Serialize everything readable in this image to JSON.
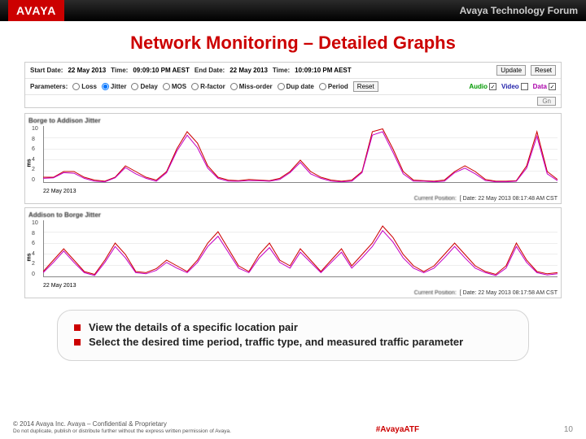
{
  "header": {
    "logo": "AVAYA",
    "forum": "Avaya Technology Forum"
  },
  "title": "Network Monitoring – Detailed Graphs",
  "controls": {
    "start_label": "Start Date:",
    "start_date": "22 May 2013",
    "start_time_label": "Time:",
    "start_time": "09:09:10 PM AEST",
    "end_label": "End Date:",
    "end_date": "22 May 2013",
    "end_time_label": "Time:",
    "end_time": "10:09:10 PM AEST",
    "update": "Update",
    "reset": "Reset",
    "param_label": "Parameters:",
    "params": [
      "Loss",
      "Jitter",
      "Delay",
      "MOS",
      "R-factor",
      "Miss-order",
      "Dup date",
      "Period"
    ],
    "selected_param": "Jitter",
    "audio": "Audio",
    "video": "Video",
    "data": "Data",
    "gn": "Gn"
  },
  "chart_data": [
    {
      "type": "line",
      "title": "Borge to Addison Jitter",
      "ylabel": "ms",
      "ylim": [
        0,
        10
      ],
      "yticks": [
        10,
        8,
        6,
        4,
        2,
        0
      ],
      "xdate": "22 May 2013",
      "current": "Current Position:",
      "date_val": "Date: 22 May 2013 08:17:48 AM CST",
      "x": [
        0,
        2,
        4,
        6,
        8,
        10,
        12,
        14,
        16,
        18,
        20,
        22,
        24,
        26,
        28,
        30,
        32,
        34,
        36,
        38,
        40,
        42,
        44,
        46,
        48,
        50,
        52,
        54,
        56,
        58,
        60,
        62,
        64,
        66,
        68,
        70,
        72,
        74,
        76,
        78,
        80,
        82,
        84,
        86,
        88,
        90,
        92,
        94,
        96,
        98,
        100
      ],
      "series": [
        {
          "name": "Audio",
          "color": "#cc0000",
          "values": [
            1,
            1,
            2,
            2,
            1,
            0.5,
            0.3,
            1,
            3,
            2,
            1,
            0.5,
            2,
            6,
            9,
            7,
            3,
            1,
            0.5,
            0.4,
            0.6,
            0.5,
            0.4,
            0.8,
            2,
            4,
            2,
            1,
            0.5,
            0.3,
            0.5,
            2,
            9,
            9.5,
            6,
            2,
            0.5,
            0.4,
            0.3,
            0.5,
            2,
            3,
            2,
            0.6,
            0.3,
            0.3,
            0.4,
            3,
            9,
            2,
            0.6
          ]
        },
        {
          "name": "Data",
          "color": "#c400c4",
          "values": [
            0.8,
            0.9,
            1.8,
            1.7,
            0.8,
            0.3,
            0.2,
            0.9,
            2.7,
            1.6,
            0.8,
            0.3,
            1.8,
            5.6,
            8.4,
            6.2,
            2.6,
            0.8,
            0.3,
            0.3,
            0.4,
            0.4,
            0.3,
            0.6,
            1.8,
            3.6,
            1.6,
            0.8,
            0.3,
            0.2,
            0.3,
            1.8,
            8.4,
            9,
            5.4,
            1.6,
            0.3,
            0.3,
            0.2,
            0.3,
            1.8,
            2.6,
            1.6,
            0.4,
            0.2,
            0.2,
            0.3,
            2.6,
            8.2,
            1.6,
            0.4
          ]
        }
      ]
    },
    {
      "type": "line",
      "title": "Addison to Borge Jitter",
      "ylabel": "ms",
      "ylim": [
        0,
        10
      ],
      "yticks": [
        10,
        8,
        6,
        4,
        2,
        0
      ],
      "xdate": "22 May 2013",
      "current": "Current Position:",
      "date_val": "Date: 22 May 2013 08:17:58 AM CST",
      "x": [
        0,
        2,
        4,
        6,
        8,
        10,
        12,
        14,
        16,
        18,
        20,
        22,
        24,
        26,
        28,
        30,
        32,
        34,
        36,
        38,
        40,
        42,
        44,
        46,
        48,
        50,
        52,
        54,
        56,
        58,
        60,
        62,
        64,
        66,
        68,
        70,
        72,
        74,
        76,
        78,
        80,
        82,
        84,
        86,
        88,
        90,
        92,
        94,
        96,
        98,
        100
      ],
      "series": [
        {
          "name": "Audio",
          "color": "#cc0000",
          "values": [
            1,
            3,
            5,
            3,
            1,
            0.5,
            3,
            6,
            4,
            1,
            0.8,
            1.5,
            3,
            2,
            1,
            3,
            6,
            8,
            5,
            2,
            1,
            4,
            6,
            3,
            2,
            5,
            3,
            1,
            3,
            5,
            2,
            4,
            6,
            9,
            7,
            4,
            2,
            1,
            2,
            4,
            6,
            4,
            2,
            1,
            0.5,
            2,
            6,
            3,
            1,
            0.6,
            0.8
          ]
        },
        {
          "name": "Data",
          "color": "#c400c4",
          "values": [
            0.8,
            2.6,
            4.6,
            2.6,
            0.8,
            0.3,
            2.6,
            5.4,
            3.4,
            0.8,
            0.6,
            1.2,
            2.6,
            1.6,
            0.8,
            2.6,
            5.4,
            7.2,
            4.4,
            1.6,
            0.8,
            3.4,
            5.2,
            2.6,
            1.6,
            4.4,
            2.6,
            0.8,
            2.6,
            4.4,
            1.6,
            3.4,
            5.4,
            8.2,
            6.2,
            3.4,
            1.6,
            0.8,
            1.6,
            3.4,
            5.4,
            3.4,
            1.6,
            0.8,
            0.3,
            1.6,
            5.4,
            2.6,
            0.8,
            0.4,
            0.6
          ]
        }
      ]
    }
  ],
  "bullets": {
    "b1": "View the details of a specific location pair",
    "b2": "Select the desired time period, traffic type, and measured traffic parameter"
  },
  "footer": {
    "copy": "© 2014 Avaya Inc. Avaya – Confidential & Proprietary",
    "sub": "Do not duplicate, publish or distribute further without the express written permission of Avaya.",
    "hash": "#AvayaATF",
    "page": "10"
  }
}
